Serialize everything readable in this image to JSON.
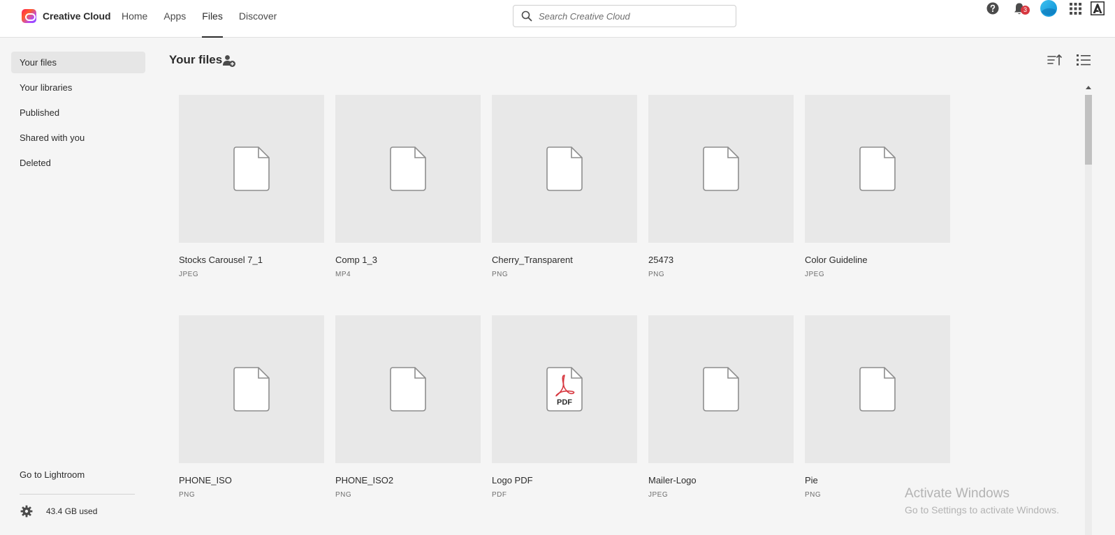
{
  "app": {
    "name": "Creative Cloud"
  },
  "nav": {
    "home": "Home",
    "apps": "Apps",
    "files": "Files",
    "discover": "Discover"
  },
  "search": {
    "placeholder": "Search Creative Cloud"
  },
  "notifications": {
    "count": "3"
  },
  "sidebar": {
    "items": [
      {
        "label": "Your files"
      },
      {
        "label": "Your libraries"
      },
      {
        "label": "Published"
      },
      {
        "label": "Shared with you"
      },
      {
        "label": "Deleted"
      }
    ],
    "lightroom": "Go to Lightroom",
    "storage": "43.4 GB used"
  },
  "main": {
    "title": "Your files"
  },
  "files": [
    {
      "name": "Stocks Carousel 7_1",
      "type": "JPEG"
    },
    {
      "name": "Comp 1_3",
      "type": "MP4"
    },
    {
      "name": "Cherry_Transparent",
      "type": "PNG"
    },
    {
      "name": "25473",
      "type": "PNG"
    },
    {
      "name": "Color Guideline",
      "type": "JPEG"
    },
    {
      "name": "PHONE_ISO",
      "type": "PNG"
    },
    {
      "name": "PHONE_ISO2",
      "type": "PNG"
    },
    {
      "name": "Logo PDF",
      "type": "PDF",
      "icon_label": "PDF"
    },
    {
      "name": "Mailer-Logo",
      "type": "JPEG"
    },
    {
      "name": "Pie",
      "type": "PNG"
    }
  ],
  "watermark": {
    "title": "Activate Windows",
    "subtitle": "Go to Settings to activate Windows."
  },
  "colors": {
    "accent": "#2c2c2c",
    "badge": "#d7373f",
    "pdf_red": "#d7373f",
    "thumb_bg": "#e8e8e8"
  }
}
